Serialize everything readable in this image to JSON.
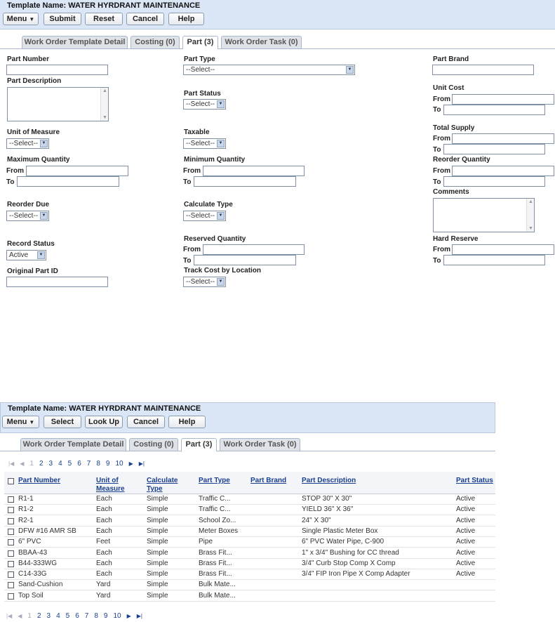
{
  "top": {
    "template_name": "Template Name: WATER HYRDRANT MAINTENANCE",
    "buttons": {
      "menu": "Menu",
      "submit": "Submit",
      "reset": "Reset",
      "cancel": "Cancel",
      "help": "Help"
    },
    "tabs": [
      "Work Order Template Detail",
      "Costing (0)",
      "Part (3)",
      "Work Order Task (0)"
    ]
  },
  "form": {
    "part_number": "Part Number",
    "part_description": "Part Description",
    "unit_of_measure": "Unit of Measure",
    "maximum_quantity": "Maximum Quantity",
    "reorder_due": "Reorder Due",
    "record_status": "Record Status",
    "record_status_value": "Active",
    "original_part_id": "Original Part ID",
    "part_type": "Part Type",
    "part_type_value": "--Select--",
    "part_status": "Part Status",
    "taxable": "Taxable",
    "minimum_quantity": "Minimum Quantity",
    "calculate_type": "Calculate Type",
    "reserved_quantity": "Reserved Quantity",
    "track_cost_by_location": "Track Cost by Location",
    "part_brand": "Part Brand",
    "unit_cost": "Unit Cost",
    "total_supply": "Total Supply",
    "reorder_quantity": "Reorder Quantity",
    "comments": "Comments",
    "hard_reserve": "Hard Reserve",
    "from": "From",
    "to": "To",
    "select_short": "--Select--"
  },
  "bottom": {
    "template_name": "Template Name: WATER HYRDRANT MAINTENANCE",
    "buttons": {
      "menu": "Menu",
      "select": "Select",
      "look_up": "Look Up",
      "cancel": "Cancel",
      "help": "Help"
    },
    "tabs": [
      "Work Order Template Detail",
      "Costing (0)",
      "Part (3)",
      "Work Order Task (0)"
    ],
    "pages": [
      "1",
      "2",
      "3",
      "4",
      "5",
      "6",
      "7",
      "8",
      "9",
      "10"
    ],
    "columns": {
      "part_number": "Part Number",
      "unit_of_measure": "Unit of Measure",
      "calculate_type": "Calculate Type",
      "part_type": "Part Type",
      "part_brand": "Part Brand",
      "part_description": "Part Description",
      "part_status": "Part Status"
    },
    "rows": [
      {
        "part_number": "R1-1",
        "unit": "Each",
        "calc": "Simple",
        "type": "Traffic C...",
        "brand": "",
        "desc": "STOP 30\" X 30\"",
        "status": "Active"
      },
      {
        "part_number": "R1-2",
        "unit": "Each",
        "calc": "Simple",
        "type": "Traffic C...",
        "brand": "",
        "desc": "YIELD 36\" X 36\"",
        "status": "Active"
      },
      {
        "part_number": "R2-1",
        "unit": "Each",
        "calc": "Simple",
        "type": "School Zo...",
        "brand": "",
        "desc": "24\" X 30\"",
        "status": "Active"
      },
      {
        "part_number": "DFW #16 AMR SB",
        "unit": "Each",
        "calc": "Simple",
        "type": "Meter Boxes",
        "brand": "",
        "desc": "Single Plastic Meter Box",
        "status": "Active"
      },
      {
        "part_number": "6\" PVC",
        "unit": "Feet",
        "calc": "Simple",
        "type": "Pipe",
        "brand": "",
        "desc": "6\" PVC Water Pipe, C-900",
        "status": "Active"
      },
      {
        "part_number": "BBAA-43",
        "unit": "Each",
        "calc": "Simple",
        "type": "Brass Fit...",
        "brand": "",
        "desc": "1\" x 3/4\" Bushing for CC thread",
        "status": "Active"
      },
      {
        "part_number": "B44-333WG",
        "unit": "Each",
        "calc": "Simple",
        "type": "Brass Fit...",
        "brand": "",
        "desc": "3/4\" Curb Stop Comp X Comp",
        "status": "Active"
      },
      {
        "part_number": "C14-33G",
        "unit": "Each",
        "calc": "Simple",
        "type": "Brass Fit...",
        "brand": "",
        "desc": "3/4\" FIP Iron Pipe X Comp Adapter",
        "status": "Active"
      },
      {
        "part_number": "Sand-Cushion",
        "unit": "Yard",
        "calc": "Simple",
        "type": "Bulk Mate...",
        "brand": "",
        "desc": "",
        "status": ""
      },
      {
        "part_number": "Top Soil",
        "unit": "Yard",
        "calc": "Simple",
        "type": "Bulk Mate...",
        "brand": "",
        "desc": "",
        "status": ""
      }
    ]
  }
}
